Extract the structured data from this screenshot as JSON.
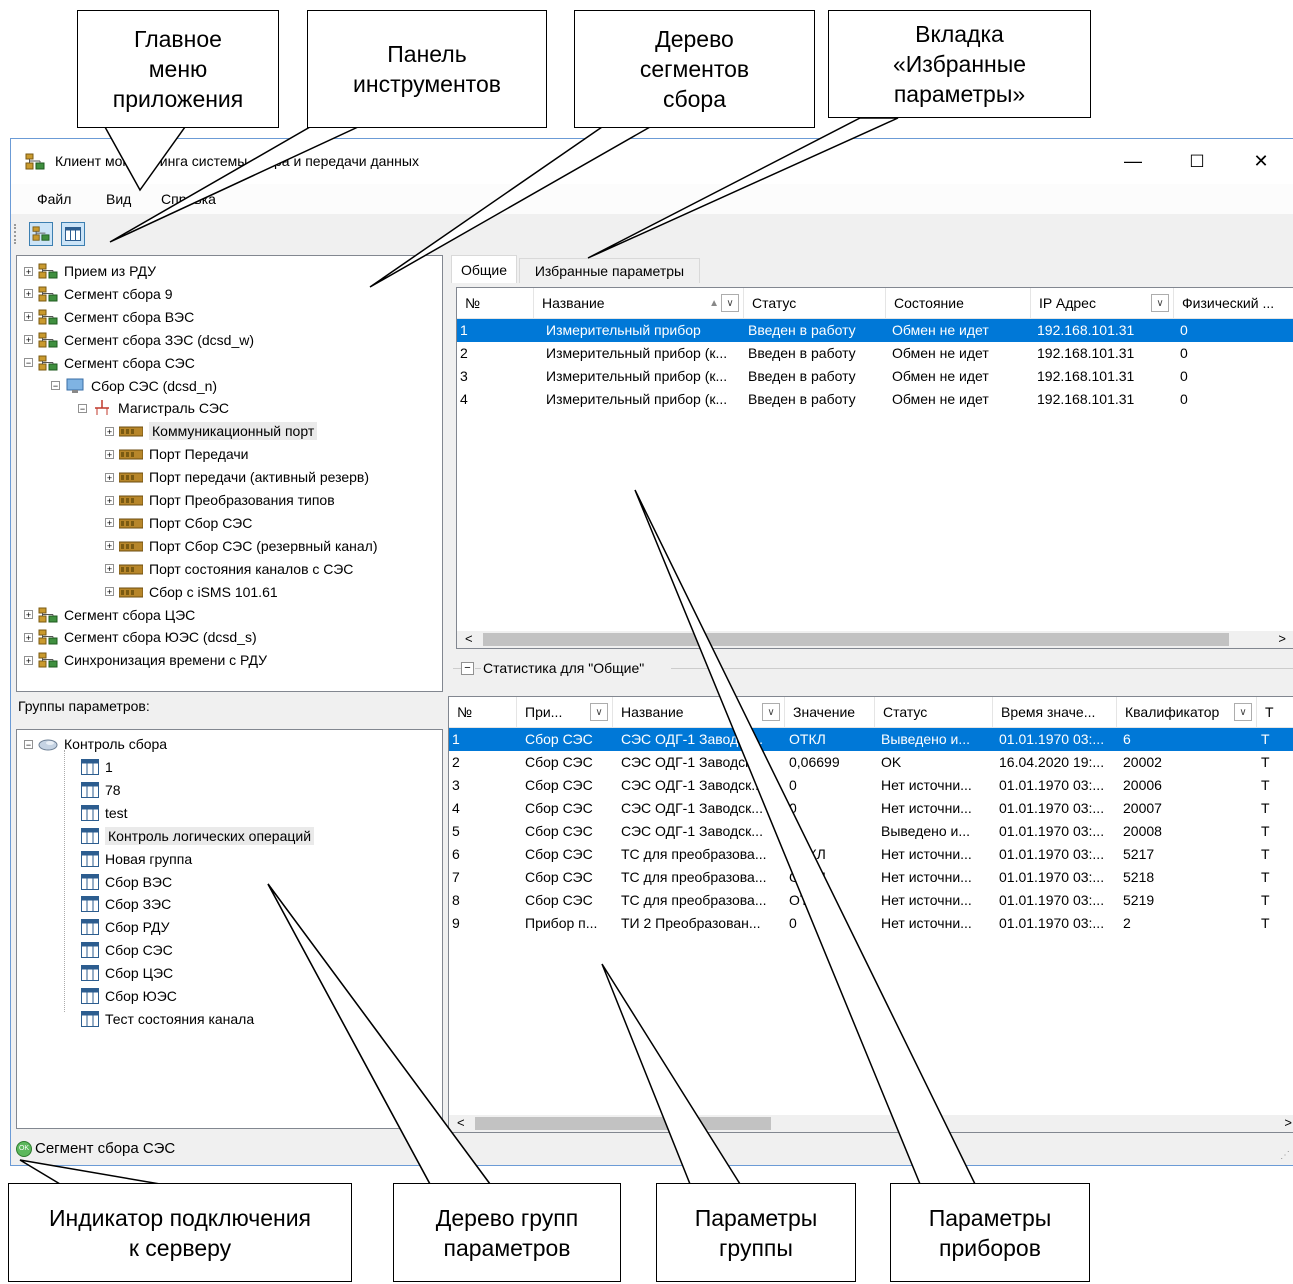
{
  "window": {
    "title": "Клиент мониторинга системы сбора и передачи данных",
    "minimize_glyph": "—",
    "maximize_glyph": "☐",
    "close_glyph": "✕"
  },
  "menu": [
    "Файл",
    "Вид",
    "Справка"
  ],
  "toolbar": {
    "buttons": [
      "tree-network-icon",
      "table-icon"
    ]
  },
  "segment_tree": {
    "items": [
      {
        "label": "Прием из РДУ",
        "level": 0,
        "expander": "+",
        "icon": "network-icon"
      },
      {
        "label": "Сегмент сбора 9",
        "level": 0,
        "expander": "+",
        "icon": "network-icon"
      },
      {
        "label": "Сегмент сбора ВЭС",
        "level": 0,
        "expander": "+",
        "icon": "network-icon"
      },
      {
        "label": "Сегмент сбора ЗЭС (dcsd_w)",
        "level": 0,
        "expander": "+",
        "icon": "network-icon"
      },
      {
        "label": "Сегмент сбора СЭС",
        "level": 0,
        "expander": "−",
        "icon": "network-icon"
      },
      {
        "label": "Сбор СЭС (dcsd_n)",
        "level": 1,
        "expander": "−",
        "icon": "monitor-icon"
      },
      {
        "label": "Магистраль СЭС",
        "level": 2,
        "expander": "−",
        "icon": "bus-icon"
      },
      {
        "label": "Коммуникационный порт",
        "level": 3,
        "expander": "+",
        "icon": "port-icon",
        "selected": true
      },
      {
        "label": "Порт Передачи",
        "level": 3,
        "expander": "+",
        "icon": "port-icon"
      },
      {
        "label": "Порт передачи (активный резерв)",
        "level": 3,
        "expander": "+",
        "icon": "port-icon"
      },
      {
        "label": "Порт Преобразования типов",
        "level": 3,
        "expander": "+",
        "icon": "port-icon"
      },
      {
        "label": "Порт Сбор СЭС",
        "level": 3,
        "expander": "+",
        "icon": "port-icon"
      },
      {
        "label": "Порт Сбор СЭС (резервный канал)",
        "level": 3,
        "expander": "+",
        "icon": "port-icon"
      },
      {
        "label": "Порт состояния каналов с СЭС",
        "level": 3,
        "expander": "+",
        "icon": "port-icon"
      },
      {
        "label": "Сбор с iSMS 101.61",
        "level": 3,
        "expander": "+",
        "icon": "port-icon"
      },
      {
        "label": "Сегмент сбора ЦЭС",
        "level": 0,
        "expander": "+",
        "icon": "network-icon"
      },
      {
        "label": "Сегмент сбора ЮЭС (dcsd_s)",
        "level": 0,
        "expander": "+",
        "icon": "network-icon"
      },
      {
        "label": "Синхронизация времени с РДУ",
        "level": 0,
        "expander": "+",
        "icon": "network-icon"
      }
    ]
  },
  "groups": {
    "header": "Группы параметров:",
    "root": "Контроль сбора",
    "items": [
      "1",
      "78",
      "test",
      "Контроль логических операций",
      "Новая группа",
      "Сбор ВЭС",
      "Сбор ЗЭС",
      "Сбор РДУ",
      "Сбор СЭС",
      "Сбор ЦЭС",
      "Сбор ЮЭС",
      "Тест состояния канала"
    ],
    "selected_index": 3
  },
  "tabs": [
    "Общие",
    "Избранные параметры"
  ],
  "devices": {
    "columns": [
      "№",
      "Название",
      "Статус",
      "Состояние",
      "IP Адрес",
      "Физический ..."
    ],
    "sort_glyph": "▲",
    "dropdown_glyph": "∨",
    "rows": [
      [
        "1",
        "Измерительный прибор",
        "Введен в работу",
        "Обмен не идет",
        "192.168.101.31",
        "0"
      ],
      [
        "2",
        "Измерительный прибор (к...",
        "Введен в работу",
        "Обмен не идет",
        "192.168.101.31",
        "0"
      ],
      [
        "3",
        "Измерительный прибор (к...",
        "Введен в работу",
        "Обмен не идет",
        "192.168.101.31",
        "0"
      ],
      [
        "4",
        "Измерительный прибор (к...",
        "Введен в работу",
        "Обмен не идет",
        "192.168.101.31",
        "0"
      ]
    ],
    "selected_row": 0,
    "scroll_left": "<",
    "scroll_right": ">"
  },
  "stats": {
    "toggle": "−",
    "label": "Статистика для \"Общие\""
  },
  "params": {
    "columns": [
      "№",
      "При...",
      "Название",
      "Значение",
      "Статус",
      "Время значе...",
      "Квалификатор",
      "Т"
    ],
    "rows": [
      [
        "1",
        "Сбор СЭС",
        "СЭС ОДГ-1 Заводск...",
        "ОТКЛ",
        "Выведено и...",
        "01.01.1970 03:...",
        "6",
        "Т"
      ],
      [
        "2",
        "Сбор СЭС",
        "СЭС ОДГ-1 Заводск...",
        "0,06699",
        "OK",
        "16.04.2020 19:...",
        "20002",
        "Т"
      ],
      [
        "3",
        "Сбор СЭС",
        "СЭС ОДГ-1 Заводск...",
        "0",
        "Нет источни...",
        "01.01.1970 03:...",
        "20006",
        "Т"
      ],
      [
        "4",
        "Сбор СЭС",
        "СЭС ОДГ-1 Заводск...",
        "0",
        "Нет источни...",
        "01.01.1970 03:...",
        "20007",
        "Т"
      ],
      [
        "5",
        "Сбор СЭС",
        "СЭС ОДГ-1 Заводск...",
        "",
        "Выведено и...",
        "01.01.1970 03:...",
        "20008",
        "Т"
      ],
      [
        "6",
        "Сбор СЭС",
        "ТС для преобразова...",
        "ОТКЛ",
        "Нет источни...",
        "01.01.1970 03:...",
        "5217",
        "Т"
      ],
      [
        "7",
        "Сбор СЭС",
        "ТС для преобразова...",
        "ОТКЛ",
        "Нет источни...",
        "01.01.1970 03:...",
        "5218",
        "Т"
      ],
      [
        "8",
        "Сбор СЭС",
        "ТС для преобразова...",
        "ОТКЛ",
        "Нет источни...",
        "01.01.1970 03:...",
        "5219",
        "Т"
      ],
      [
        "9",
        "Прибор п...",
        "ТИ 2 Преобразован...",
        "0",
        "Нет источни...",
        "01.01.1970 03:...",
        "2",
        "Т"
      ]
    ],
    "selected_row": 0,
    "scroll_left": "<",
    "scroll_right": ">"
  },
  "status": {
    "indicator": "OK",
    "text": "Сегмент сбора СЭС"
  },
  "callouts": {
    "main_menu": "Главное\nменю\nприложения",
    "toolbar": "Панель\nинструментов",
    "segment_tree": "Дерево\nсегментов\nсбора",
    "favorites_tab": "Вкладка\n«Избранные\nпараметры»",
    "server_indicator": "Индикатор подключения\nк серверу",
    "group_tree": "Дерево групп\nпараметров",
    "group_params": "Параметры\nгруппы",
    "device_params": "Параметры\nприборов"
  },
  "colors": {
    "selection": "#0078d7",
    "window_border": "#6b9bd6",
    "status_ok": "#5cb85c"
  }
}
